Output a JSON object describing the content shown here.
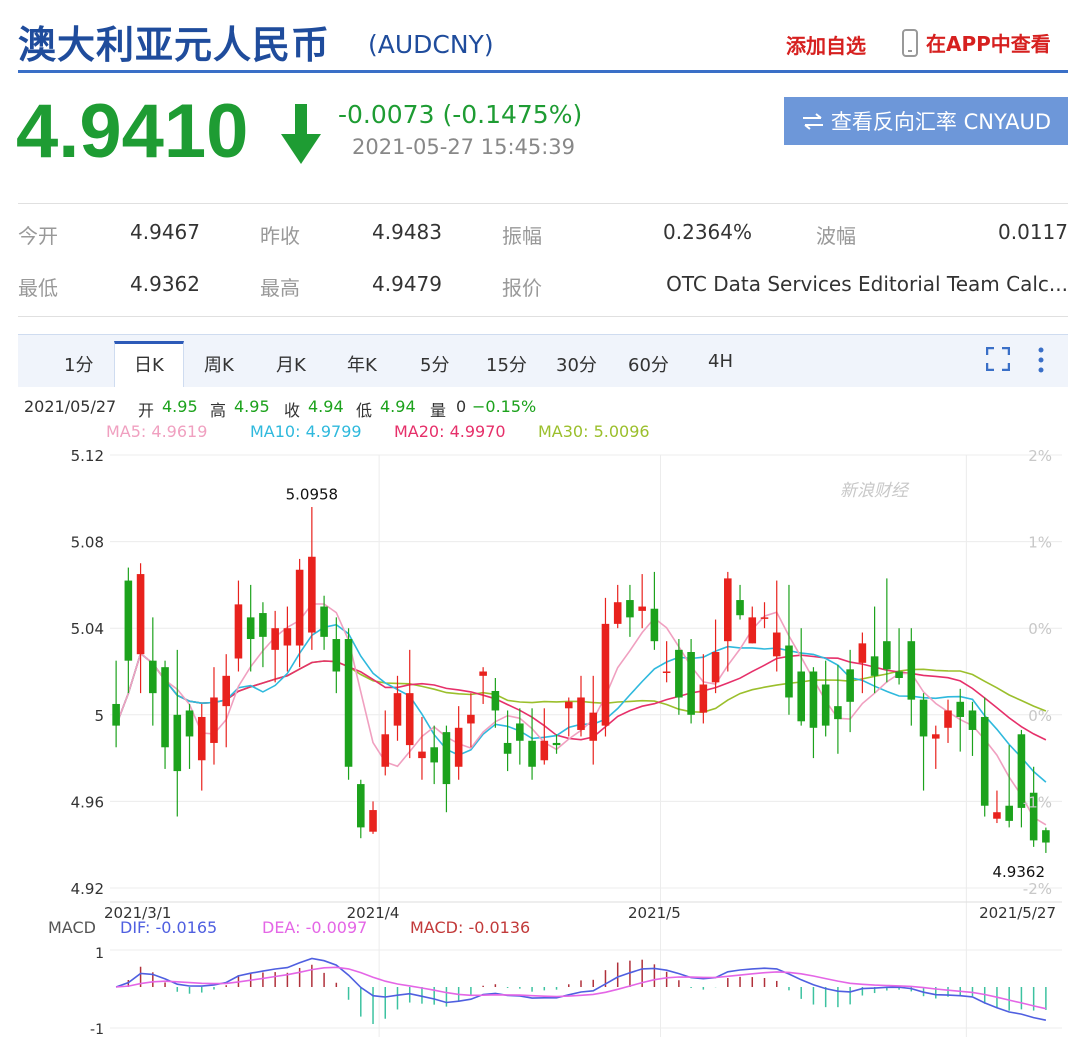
{
  "header": {
    "name": "澳大利亚元人民币",
    "code": "(AUDCNY)",
    "add_watch": "添加自选",
    "app_view": "在APP中查看"
  },
  "quote": {
    "price": "4.9410",
    "change": "-0.0073 (-0.1475%)",
    "time": "2021-05-27 15:45:39",
    "direction": "down",
    "reverse_button": "查看反向汇率 CNYAUD",
    "reverse_icon": "swap-arrows-icon"
  },
  "stats": {
    "open_label": "今开",
    "open": "4.9467",
    "prev_close_label": "昨收",
    "prev_close": "4.9483",
    "amplitude_label": "振幅",
    "amplitude": "0.2364%",
    "swing_label": "波幅",
    "swing": "0.0117",
    "low_label": "最低",
    "low": "4.9362",
    "high_label": "最高",
    "high": "4.9479",
    "quote_label": "报价",
    "quote_source": "OTC Data Services Editorial Team Calc..."
  },
  "tabs": [
    "1分",
    "日K",
    "周K",
    "月K",
    "年K",
    "5分",
    "15分",
    "30分",
    "60分",
    "4H"
  ],
  "active_tab": 1,
  "info": {
    "date": "2021/05/27",
    "open_label": "开",
    "open": "4.95",
    "high_label": "高",
    "high": "4.95",
    "close_label": "收",
    "close": "4.94",
    "low_label": "低",
    "low": "4.94",
    "vol_label": "量",
    "vol": "0",
    "pct": "−0.15%"
  },
  "ma": {
    "ma5": "MA5: 4.9619",
    "ma10": "MA10: 4.9799",
    "ma20": "MA20: 4.9970",
    "ma30": "MA30: 5.0096"
  },
  "macd_info": {
    "label": "MACD",
    "dif": "DIF: -0.0165",
    "dea": "DEA: -0.0097",
    "macd": "MACD: -0.0136"
  },
  "watermark": "新浪财经",
  "colors": {
    "up": "#e8221d",
    "down": "#1ca21c",
    "ma5": "#f0a0c0",
    "ma10": "#2fb9dd",
    "ma20": "#e6306a",
    "ma30": "#9bbf2c",
    "dif": "#4f5fe0",
    "dea": "#e466e6",
    "macd_text": "#c23a3a"
  },
  "chart_data": {
    "type": "candlestick",
    "ylim": [
      4.92,
      5.12
    ],
    "yticks": [
      "5.12",
      "5.08",
      "5.04",
      "5",
      "4.96",
      "4.92"
    ],
    "pct_ticks": [
      "2%",
      "1%",
      "0%",
      "0%",
      "-1%",
      "-2%"
    ],
    "xticks": [
      "2021/3/1",
      "2021/4",
      "2021/5",
      "2021/5/27"
    ],
    "annotations": {
      "max_label": "5.0958",
      "max_index": 16,
      "max_value": 5.0958,
      "min_label": "4.9362",
      "min_index": 76,
      "min_value": 4.9362
    },
    "candles": [
      [
        5.005,
        4.995,
        5.025,
        4.985
      ],
      [
        5.062,
        5.025,
        5.068,
        5.01
      ],
      [
        5.028,
        5.065,
        5.07,
        5.01
      ],
      [
        5.025,
        5.01,
        5.045,
        4.995
      ],
      [
        5.022,
        4.985,
        5.025,
        4.975
      ],
      [
        5.0,
        4.974,
        5.03,
        4.953
      ],
      [
        5.002,
        4.99,
        5.005,
        4.975
      ],
      [
        4.979,
        4.999,
        5.005,
        4.965
      ],
      [
        4.987,
        5.008,
        5.022,
        4.977
      ],
      [
        5.004,
        5.018,
        5.028,
        4.985
      ],
      [
        5.026,
        5.051,
        5.062,
        5.02
      ],
      [
        5.045,
        5.035,
        5.06,
        5.02
      ],
      [
        5.047,
        5.036,
        5.052,
        5.022
      ],
      [
        5.03,
        5.04,
        5.048,
        5.015
      ],
      [
        5.032,
        5.04,
        5.05,
        5.02
      ],
      [
        5.032,
        5.067,
        5.072,
        5.022
      ],
      [
        5.038,
        5.073,
        5.096,
        5.03
      ],
      [
        5.05,
        5.036,
        5.055,
        5.03
      ],
      [
        5.035,
        5.02,
        5.045,
        5.01
      ],
      [
        5.035,
        4.976,
        5.04,
        4.97
      ],
      [
        4.968,
        4.948,
        4.97,
        4.943
      ],
      [
        4.946,
        4.956,
        4.96,
        4.945
      ],
      [
        4.976,
        4.991,
        5.002,
        4.972
      ],
      [
        4.995,
        5.01,
        5.018,
        4.988
      ],
      [
        4.986,
        5.01,
        5.03,
        4.98
      ],
      [
        4.98,
        4.983,
        4.999,
        4.97
      ],
      [
        4.985,
        4.978,
        4.995,
        4.968
      ],
      [
        4.992,
        4.968,
        4.995,
        4.955
      ],
      [
        4.976,
        4.994,
        5.004,
        4.97
      ],
      [
        4.996,
        5.0,
        5.01,
        4.985
      ],
      [
        5.018,
        5.02,
        5.022,
        5.005
      ],
      [
        5.011,
        5.002,
        5.017,
        4.994
      ],
      [
        4.987,
        4.982,
        5.002,
        4.974
      ],
      [
        4.996,
        4.988,
        5.003,
        4.977
      ],
      [
        4.988,
        4.976,
        5.003,
        4.97
      ],
      [
        4.979,
        4.988,
        5.003,
        4.977
      ],
      [
        4.987,
        4.986,
        4.991,
        4.982
      ],
      [
        5.003,
        5.006,
        5.008,
        4.99
      ],
      [
        4.993,
        5.008,
        5.018,
        4.99
      ],
      [
        4.988,
        5.001,
        5.018,
        4.977
      ],
      [
        4.995,
        5.042,
        5.054,
        4.99
      ],
      [
        5.042,
        5.052,
        5.06,
        5.04
      ],
      [
        5.053,
        5.045,
        5.06,
        5.036
      ],
      [
        5.048,
        5.05,
        5.065,
        5.04
      ],
      [
        5.049,
        5.034,
        5.066,
        5.03
      ],
      [
        5.02,
        5.02,
        5.034,
        5.015
      ],
      [
        5.03,
        5.008,
        5.035,
        5.0
      ],
      [
        5.029,
        5.0,
        5.035,
        4.996
      ],
      [
        5.001,
        5.014,
        5.028,
        4.996
      ],
      [
        5.015,
        5.029,
        5.044,
        5.01
      ],
      [
        5.034,
        5.063,
        5.066,
        5.02
      ],
      [
        5.053,
        5.046,
        5.06,
        5.044
      ],
      [
        5.033,
        5.045,
        5.05,
        5.033
      ],
      [
        5.045,
        5.045,
        5.052,
        5.04
      ],
      [
        5.027,
        5.038,
        5.062,
        5.02
      ],
      [
        5.032,
        5.008,
        5.06,
        5.0
      ],
      [
        5.02,
        4.997,
        5.04,
        4.995
      ],
      [
        5.02,
        4.994,
        5.022,
        4.98
      ],
      [
        5.014,
        4.995,
        5.025,
        4.99
      ],
      [
        5.004,
        4.998,
        5.023,
        4.982
      ],
      [
        5.021,
        5.006,
        5.03,
        4.992
      ],
      [
        5.024,
        5.033,
        5.038,
        5.01
      ],
      [
        5.027,
        5.018,
        5.05,
        5.01
      ],
      [
        5.034,
        5.021,
        5.063,
        5.015
      ],
      [
        5.02,
        5.017,
        5.04,
        5.014
      ],
      [
        5.034,
        5.007,
        5.04,
        4.995
      ],
      [
        5.007,
        4.99,
        5.01,
        4.965
      ],
      [
        4.989,
        4.991,
        4.995,
        4.975
      ],
      [
        4.994,
        5.002,
        5.007,
        4.987
      ],
      [
        5.006,
        4.999,
        5.012,
        4.983
      ],
      [
        5.002,
        4.993,
        5.006,
        4.981
      ],
      [
        4.999,
        4.958,
        5.008,
        4.953
      ],
      [
        4.952,
        4.955,
        4.965,
        4.95
      ],
      [
        4.958,
        4.951,
        4.986,
        4.948
      ],
      [
        4.991,
        4.957,
        4.993,
        4.948
      ],
      [
        4.964,
        4.942,
        4.976,
        4.939
      ],
      [
        4.9467,
        4.941,
        4.9479,
        4.9362
      ]
    ]
  }
}
